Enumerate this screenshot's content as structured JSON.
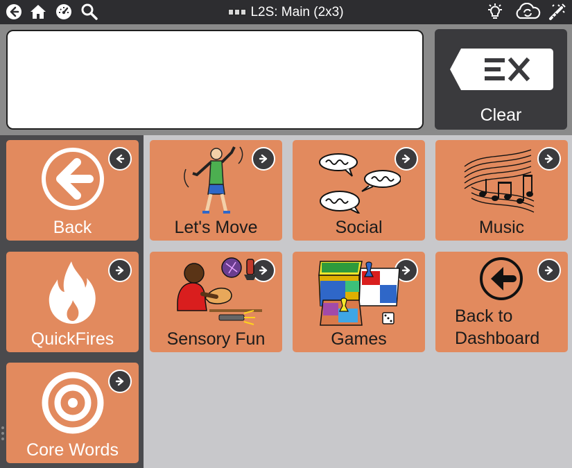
{
  "topbar": {
    "title": "L2S: Main (2x3)",
    "icons": [
      "back-icon",
      "home-icon",
      "dashboard-gauge-icon",
      "search-icon",
      "brightness-icon",
      "cloud-sync-icon",
      "edit-wand-icon"
    ]
  },
  "message": {
    "text": ""
  },
  "clear": {
    "label": "Clear"
  },
  "sidebar": {
    "back": "Back",
    "quickfires": "QuickFires",
    "core_words": "Core Words"
  },
  "grid": {
    "lets_move": "Let's Move",
    "social": "Social",
    "music": "Music",
    "sensory_fun": "Sensory Fun",
    "games": "Games",
    "back_to_dashboard_line1": "Back to",
    "back_to_dashboard_line2": "Dashboard"
  },
  "colors": {
    "cell": "#e28a5e",
    "topbar": "#2d2d30",
    "sidebar": "#4a4a4d",
    "grid_bg": "#c8c8cb"
  }
}
